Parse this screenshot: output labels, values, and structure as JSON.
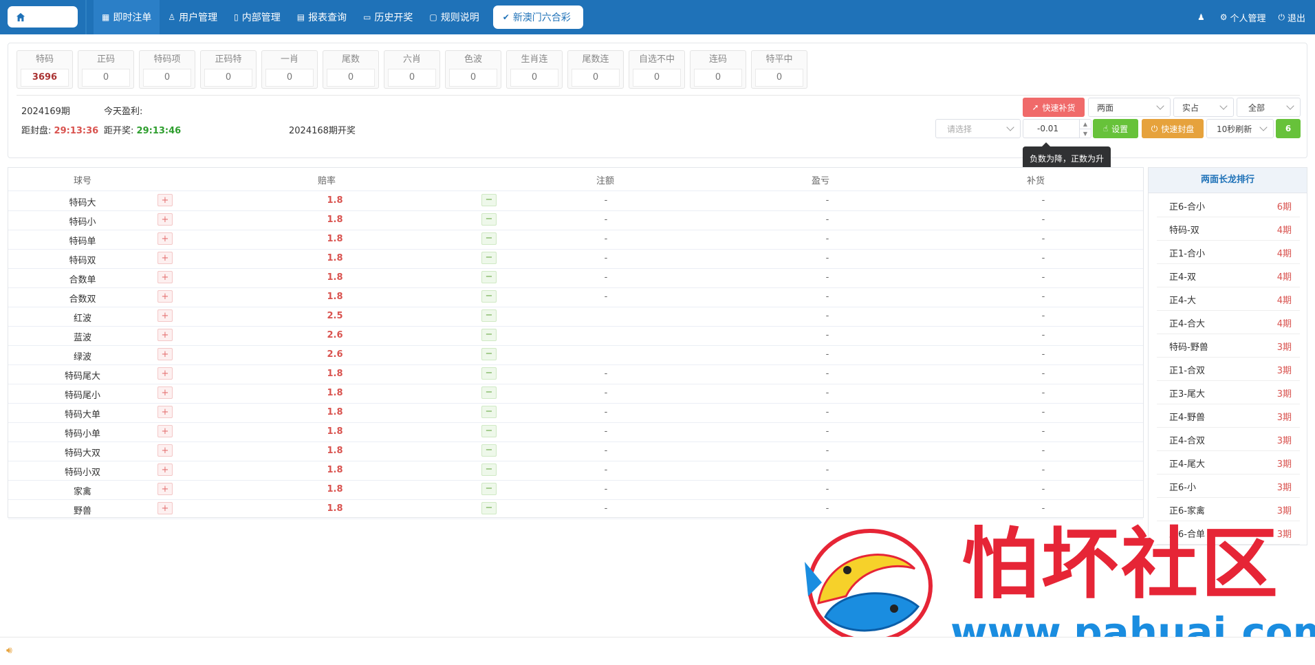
{
  "nav": {
    "items": [
      {
        "label": "即时注单",
        "icon": "grid-icon"
      },
      {
        "label": "用户管理",
        "icon": "user-icon"
      },
      {
        "label": "内部管理",
        "icon": "book-icon"
      },
      {
        "label": "报表查询",
        "icon": "report-icon"
      },
      {
        "label": "历史开奖",
        "icon": "monitor-icon"
      },
      {
        "label": "规则说明",
        "icon": "chat-icon"
      }
    ],
    "game_label": "新澳门六合彩",
    "personal": "个人管理",
    "logout": "退出"
  },
  "categories": [
    {
      "name": "特码",
      "value": "3696"
    },
    {
      "name": "正码",
      "value": "0"
    },
    {
      "name": "特码项",
      "value": "0"
    },
    {
      "name": "正码特",
      "value": "0"
    },
    {
      "name": "一肖",
      "value": "0"
    },
    {
      "name": "尾数",
      "value": "0"
    },
    {
      "name": "六肖",
      "value": "0"
    },
    {
      "name": "色波",
      "value": "0"
    },
    {
      "name": "生肖连",
      "value": "0"
    },
    {
      "name": "尾数连",
      "value": "0"
    },
    {
      "name": "自选不中",
      "value": "0"
    },
    {
      "name": "连码",
      "value": "0"
    },
    {
      "name": "特平中",
      "value": "0"
    }
  ],
  "info": {
    "period": "2024169期",
    "today_profit_label": "今天盈利:",
    "close_label": "距封盘:",
    "close_time": "29:13:36",
    "open_label": "距开奖:",
    "open_time": "29:13:46",
    "last_draw": "2024168期开奖"
  },
  "controls": {
    "quick_fill": "快速补货",
    "mode": "两面",
    "share": "实占",
    "range": "全部",
    "select_placeholder": "请选择",
    "adjust_value": "-0.01",
    "set_label": "设置",
    "quick_seal": "快速封盘",
    "refresh": "10秒刷新",
    "count": "6",
    "tooltip": "负数为降，正数为升"
  },
  "table": {
    "headers": [
      "球号",
      "赔率",
      "注额",
      "盈亏",
      "补货"
    ],
    "rows": [
      {
        "name": "特码大",
        "rate": "1.8",
        "bet": "-",
        "pl": "-",
        "fill": "-"
      },
      {
        "name": "特码小",
        "rate": "1.8",
        "bet": "-",
        "pl": "-",
        "fill": "-"
      },
      {
        "name": "特码单",
        "rate": "1.8",
        "bet": "-",
        "pl": "-",
        "fill": "-"
      },
      {
        "name": "特码双",
        "rate": "1.8",
        "bet": "-",
        "pl": "-",
        "fill": "-"
      },
      {
        "name": "合数单",
        "rate": "1.8",
        "bet": "-",
        "pl": "-",
        "fill": "-"
      },
      {
        "name": "合数双",
        "rate": "1.8",
        "bet": "-",
        "pl": "-",
        "fill": "-"
      },
      {
        "name": "红波",
        "rate": "2.5",
        "bet": "",
        "pl": "-",
        "fill": "-"
      },
      {
        "name": "蓝波",
        "rate": "2.6",
        "bet": "",
        "pl": "-",
        "fill": "-"
      },
      {
        "name": "绿波",
        "rate": "2.6",
        "bet": "",
        "pl": "-",
        "fill": "-"
      },
      {
        "name": "特码尾大",
        "rate": "1.8",
        "bet": "-",
        "pl": "-",
        "fill": "-"
      },
      {
        "name": "特码尾小",
        "rate": "1.8",
        "bet": "-",
        "pl": "-",
        "fill": "-"
      },
      {
        "name": "特码大单",
        "rate": "1.8",
        "bet": "-",
        "pl": "-",
        "fill": "-"
      },
      {
        "name": "特码小单",
        "rate": "1.8",
        "bet": "-",
        "pl": "-",
        "fill": "-"
      },
      {
        "name": "特码大双",
        "rate": "1.8",
        "bet": "-",
        "pl": "-",
        "fill": "-"
      },
      {
        "name": "特码小双",
        "rate": "1.8",
        "bet": "-",
        "pl": "-",
        "fill": "-"
      },
      {
        "name": "家禽",
        "rate": "1.8",
        "bet": "-",
        "pl": "-",
        "fill": "-"
      },
      {
        "name": "野兽",
        "rate": "1.8",
        "bet": "-",
        "pl": "-",
        "fill": "-"
      }
    ]
  },
  "ranking": {
    "title": "两面长龙排行",
    "items": [
      {
        "name": "正6-合小",
        "periods": "6期"
      },
      {
        "name": "特码-双",
        "periods": "4期"
      },
      {
        "name": "正1-合小",
        "periods": "4期"
      },
      {
        "name": "正4-双",
        "periods": "4期"
      },
      {
        "name": "正4-大",
        "periods": "4期"
      },
      {
        "name": "正4-合大",
        "periods": "4期"
      },
      {
        "name": "特码-野兽",
        "periods": "3期"
      },
      {
        "name": "正1-合双",
        "periods": "3期"
      },
      {
        "name": "正3-尾大",
        "periods": "3期"
      },
      {
        "name": "正4-野兽",
        "periods": "3期"
      },
      {
        "name": "正4-合双",
        "periods": "3期"
      },
      {
        "name": "正4-尾大",
        "periods": "3期"
      },
      {
        "name": "正6-小",
        "periods": "3期"
      },
      {
        "name": "正6-家禽",
        "periods": "3期"
      },
      {
        "name": "正6-合单",
        "periods": "3期"
      }
    ]
  },
  "watermark": {
    "title": "怕坏社区",
    "url": "www.pahuai.com"
  },
  "colors": {
    "primary": "#1f72b8",
    "danger": "#f06a6a",
    "success": "#67c23a",
    "warning": "#e6a23c"
  }
}
